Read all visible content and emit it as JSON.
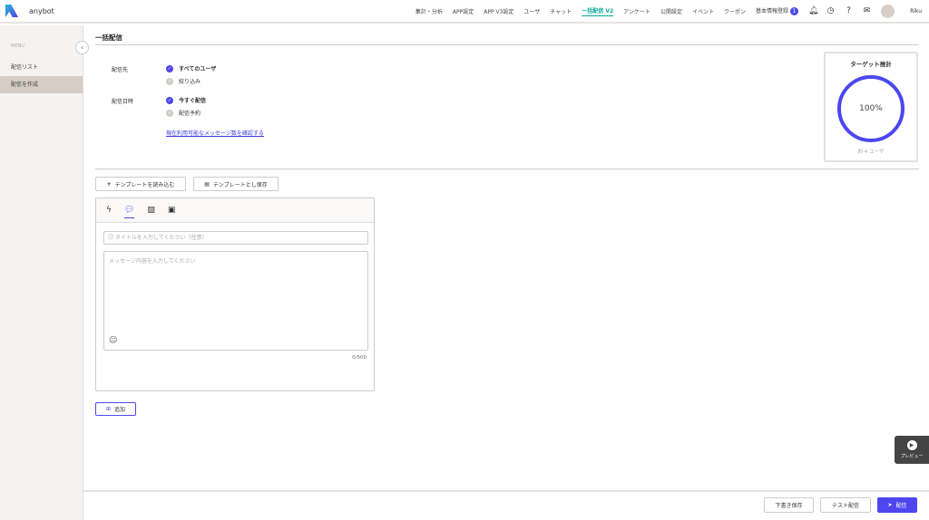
{
  "app": {
    "name": "anybot",
    "user": "Riku"
  },
  "nav": {
    "items": [
      "集計・分析",
      "APP設定",
      "APP V3設定",
      "ユーザ",
      "チャット",
      "一括配信 V2",
      "アンケート",
      "公開設定",
      "イベント",
      "クーポン",
      "基本情報登録"
    ],
    "active": "一括配信 V2",
    "badge": "1"
  },
  "sidebar": {
    "heading": "MENU",
    "items": [
      "配信リスト",
      "配信を作成"
    ],
    "active": "配信を作成"
  },
  "page": {
    "title": "一括配信"
  },
  "form": {
    "recipient_label": "配信先",
    "recipient_options": [
      "すべてのユーザ",
      "絞り込み"
    ],
    "datetime_label": "配信日時",
    "datetime_options": [
      "今すぐ配信",
      "配信予約"
    ],
    "check_link": "現在利用可能なメッセージ数を確認する"
  },
  "target": {
    "title": "ターゲット推計",
    "percent": "100%",
    "percent_value": 100,
    "users": "約 4 ユーザ"
  },
  "templates": {
    "load": "テンプレートを読み込む",
    "save": "テンプレートとし保存"
  },
  "editor": {
    "title_placeholder": "タイトルを入力してください（任意）",
    "message_placeholder": "メッセージ内容を入力してください",
    "counter": "0/500"
  },
  "add_label": "追加",
  "preview_label": "プレビュー",
  "footer": {
    "draft": "下書き保存",
    "test": "テスト配信",
    "send": "配信"
  },
  "colors": {
    "accent": "#5046f0",
    "nav_active": "#0aa79b"
  }
}
